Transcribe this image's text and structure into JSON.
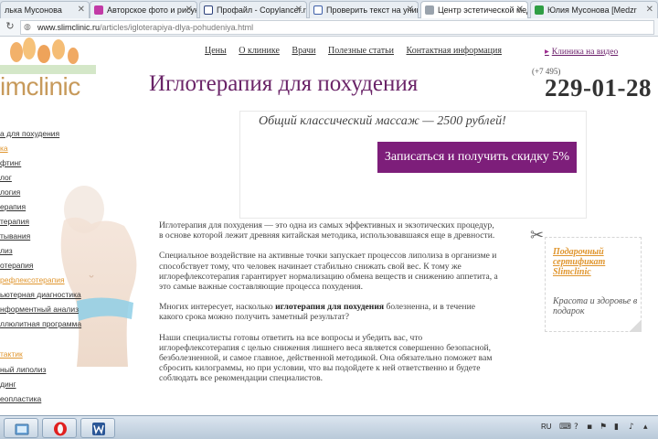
{
  "browser": {
    "tabs": [
      {
        "label": "лька Мусонова",
        "icon": "tab-page-icon",
        "active": false
      },
      {
        "label": "Авторское фото и рисунк",
        "icon": "pink-circle-icon",
        "active": false
      },
      {
        "label": "Профайл - Copylancer.ru",
        "icon": "copylancer-icon",
        "active": false
      },
      {
        "label": "Проверить текст на уник",
        "icon": "document-icon",
        "active": false
      },
      {
        "label": "Центр эстетической меди",
        "icon": "clinic-icon",
        "active": true
      },
      {
        "label": "Юлия Мусонова [Medzr",
        "icon": "green-circle-icon",
        "active": false
      }
    ],
    "url_domain": "www.slimclinic.ru",
    "url_path": "/articles/igloterapiya-dlya-pohudeniya.html"
  },
  "site": {
    "logo_text": "imclinic",
    "nav": [
      "Цены",
      "О клинике",
      "Врачи",
      "Полезные статьи",
      "Контактная информация"
    ],
    "video_link": "Клиника на видео",
    "phone_code": "(+7 495)",
    "phone_number": "229-01-28"
  },
  "page": {
    "title": "Иглотерапия для похудения",
    "promo_text": "Общий классический массаж — 2500 рублей!",
    "promo_button": "Записаться и получить скидку 5%"
  },
  "sidebar": {
    "items": [
      {
        "label": "а для похудения",
        "orange": false
      },
      {
        "label": "ка",
        "orange": true
      },
      {
        "label": "фтинг",
        "orange": false
      },
      {
        "label": "лог",
        "orange": false
      },
      {
        "label": "логия",
        "orange": false
      },
      {
        "label": "ерапия",
        "orange": false
      },
      {
        "label": "терапия",
        "orange": false
      },
      {
        "label": "тывания",
        "orange": false
      },
      {
        "label": "лиз",
        "orange": false
      },
      {
        "label": "отерапия",
        "orange": false
      },
      {
        "label": "рефлексотерапия",
        "orange": true
      },
      {
        "label": "ьютерная диагностика",
        "orange": false
      },
      {
        "label": "нформентный анализ",
        "orange": false
      },
      {
        "label": "ллюлитная программа",
        "orange": false
      },
      {
        "label": "тактик",
        "orange": true
      },
      {
        "label": "ный липолиз",
        "orange": false
      },
      {
        "label": "динг",
        "orange": false
      },
      {
        "label": "еопластика",
        "orange": false
      }
    ]
  },
  "article": {
    "p1": "Иглотерапия для похудения — это одна из самых эффективных и экзотических процедур, в основе которой лежит древняя китайская методика, использовавшаяся еще в древности.",
    "p2": "Специальное воздействие на активные точки запускает процессов липолиза в организме и способствует тому, что человек начинает стабильно снижать свой вес. К тому же иглорефлексотерапия гарантирует нормализацию обмена веществ и снижению аппетита, а это самые важные составляющие процесса похудения.",
    "p3_before": "Многих интересует, насколько ",
    "p3_bold": "иглотерапия для похудения",
    "p3_after": " болезненна, и в течение какого срока можно получить заметный результат?",
    "p4": "Наши специалисты готовы ответить на все вопросы и убедить вас, что иглорефлексотерапия с целью снижения лишнего веса является совершенно безопасной, безболезненной, и самое главное, действенной методикой. Она обязательно поможет вам сбросить килограммы, но при условии, что вы подойдете к ней ответственно и будете соблюдать все рекомендации специалистов."
  },
  "gift": {
    "title": "Подарочный сертификат Slimclinic",
    "subtitle": "Красота и здоровье в подарок"
  },
  "taskbar": {
    "language": "RU"
  },
  "colors": {
    "brand_purple": "#7d1e7a",
    "title_purple": "#6a2468",
    "logo_gold": "#c79a5b",
    "accent_orange": "#e0962f"
  }
}
